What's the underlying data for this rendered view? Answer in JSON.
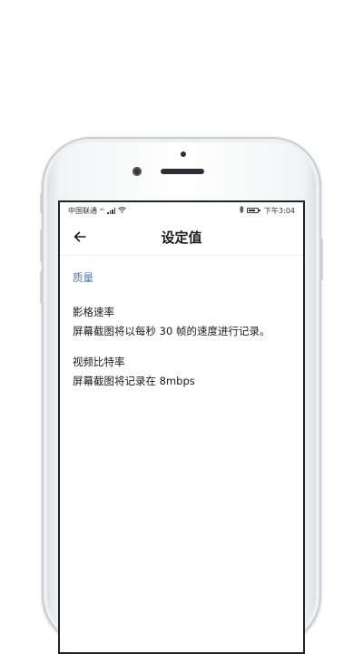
{
  "status_bar": {
    "carrier": "中国联通",
    "network": "⁴ᴳ",
    "time": "下午3:04"
  },
  "app_bar": {
    "title": "设定值"
  },
  "sections": [
    {
      "header": "质量",
      "items": [
        {
          "title": "影格速率",
          "description": "屏幕截图将以每秒 30 帧的速度进行记录。"
        },
        {
          "title": "视频比特率",
          "description": "屏幕截图将记录在 8mbps"
        }
      ]
    }
  ],
  "colors": {
    "accent": "#4a78b0",
    "text": "#1a1a1a",
    "device_frame": "#e9ebed"
  }
}
